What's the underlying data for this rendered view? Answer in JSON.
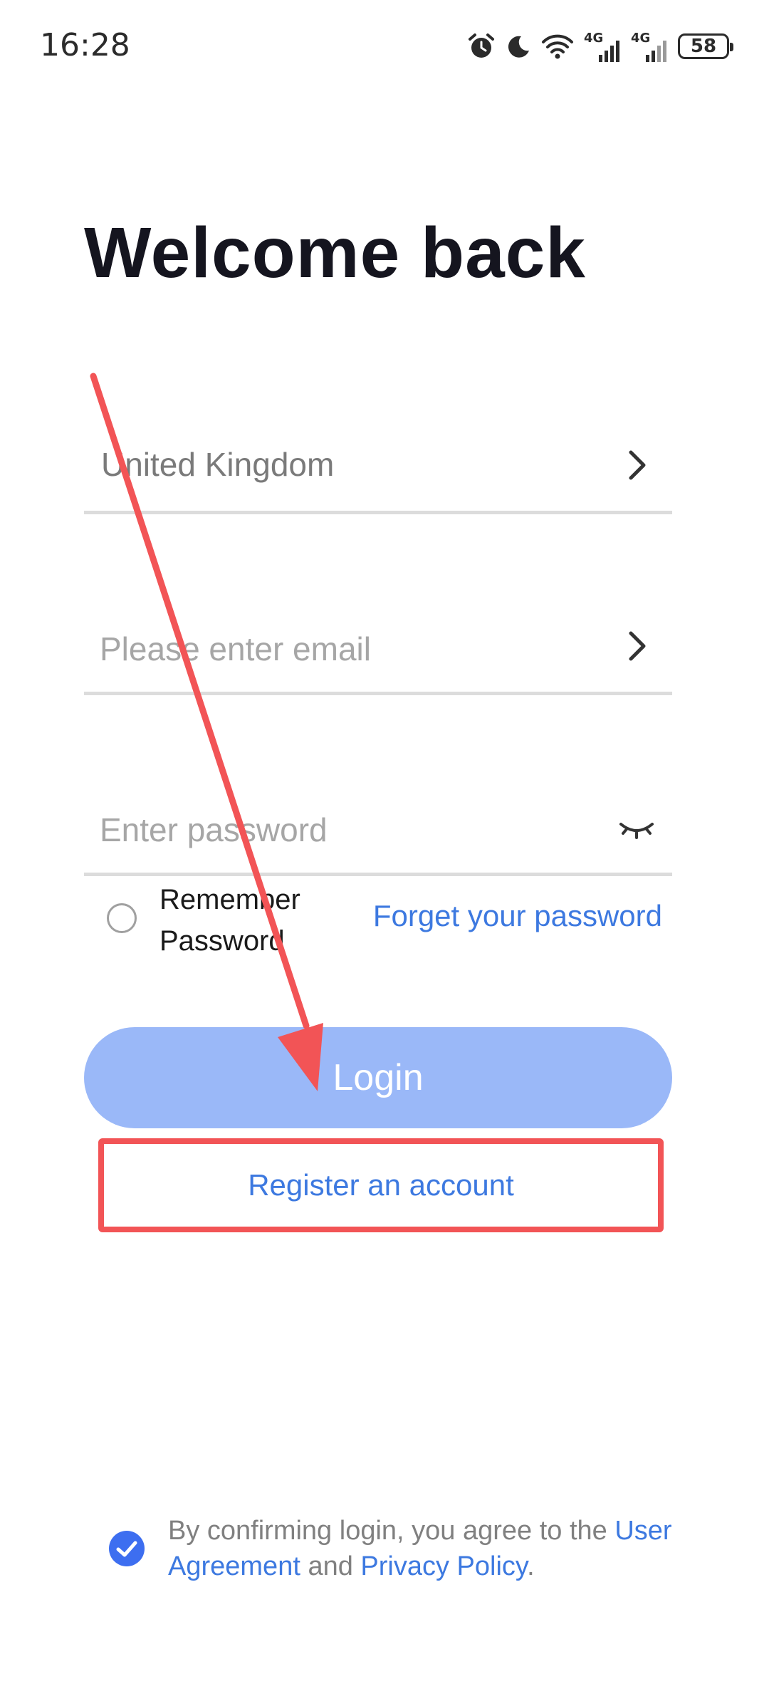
{
  "status_bar": {
    "time": "16:28",
    "network_1": "4G",
    "network_2": "4G",
    "battery": "58",
    "icons": [
      "alarm-icon",
      "moon-icon",
      "wifi-icon",
      "signal-icon",
      "signal-icon",
      "battery-icon"
    ]
  },
  "page": {
    "title": "Welcome back"
  },
  "form": {
    "country_value": "United Kingdom",
    "email_placeholder": "Please enter email",
    "password_placeholder": "Enter password",
    "remember_label": "Remember Password",
    "forgot_link": "Forget your password",
    "login_button": "Login",
    "register_link": "Register an account"
  },
  "agreement": {
    "text_before": "By confirming login, you agree to the ",
    "user_agreement": "User Agreement",
    "and_text": " and ",
    "privacy_policy": "Privacy Policy",
    "period": ".",
    "checked": true
  },
  "colors": {
    "link_blue": "#3d79e0",
    "login_button_bg": "#9ab8f8",
    "annotation_red": "#f25456",
    "check_blue": "#3d6ef0"
  }
}
